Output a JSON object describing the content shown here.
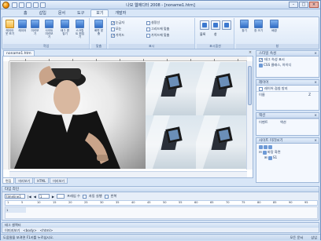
{
  "window": {
    "title": "나모 웹에디터 2008 - [noname1.htm]",
    "controls": [
      "–",
      "□",
      "×"
    ]
  },
  "ribbon": {
    "tabs": [
      "홈",
      "삽입",
      "문서",
      "도구",
      "보기",
      "개발자"
    ],
    "active_tab": "보기",
    "groups": [
      {
        "label": "작업",
        "buttons": [
          "레이아웃 보기",
          "레이어",
          "미리보기",
          "사이트 미리보기",
          "태그 편집기",
          "스크립트 편집기"
        ]
      },
      {
        "label": "맞춤",
        "buttons": [
          "화면 맞춤"
        ]
      },
      {
        "label": "표시",
        "checks": [
          {
            "label": "눈금자",
            "checked": true
          },
          {
            "label": "모눈",
            "checked": false
          },
          {
            "label": "가이드",
            "checked": true
          },
          {
            "label": "설정선",
            "checked": false
          },
          {
            "label": "그리드에 맞춤",
            "checked": false
          },
          {
            "label": "가이드에 맞춤",
            "checked": false
          }
        ]
      },
      {
        "label": "표시옵션",
        "buttons": [
          "블록",
          "창"
        ]
      },
      {
        "label": "창",
        "buttons": [
          "찾기",
          "창 크기",
          "배경"
        ]
      }
    ]
  },
  "document": {
    "tab": "noname1.htm",
    "view_tabs": [
      "편집",
      "미리보기",
      "HTML",
      "미리보기"
    ],
    "active_view": "편집"
  },
  "panels": {
    "style": {
      "title": "스타일 속성",
      "check_label": "태그 속성 표시",
      "row": "CSS 클래스, 아이디"
    },
    "layer": {
      "title": "레이어",
      "check_label": "레이어 겹침 방지",
      "col_name": "이름",
      "col_z": "Z"
    },
    "event": {
      "title": "액션",
      "col_event": "이벤트",
      "col_action": "액션"
    },
    "site": {
      "title": "사이트 미리보기",
      "root": "바탕 화면",
      "child": "S1"
    }
  },
  "timeline": {
    "title": "타임 라인",
    "name_value": "timeline1",
    "frame_value": "1",
    "fps_label": "프레임 수",
    "loop_label": "자동 실행",
    "repeat_label": "반복",
    "ruler": [
      "1",
      "5",
      "10",
      "15",
      "20",
      "25",
      "30",
      "35",
      "40",
      "45",
      "50",
      "55",
      "60",
      "65",
      "70",
      "75",
      "80",
      "85",
      "90",
      "95"
    ],
    "channel": "1"
  },
  "tag_selector": {
    "title": "태그 셀렉터",
    "items": [
      "이미지보기",
      "<body>",
      "<html>"
    ]
  },
  "status": {
    "left": "도움말을 보려면 F1키를 누르십시오.",
    "right": [
      "모든 문서",
      "삽입"
    ]
  }
}
